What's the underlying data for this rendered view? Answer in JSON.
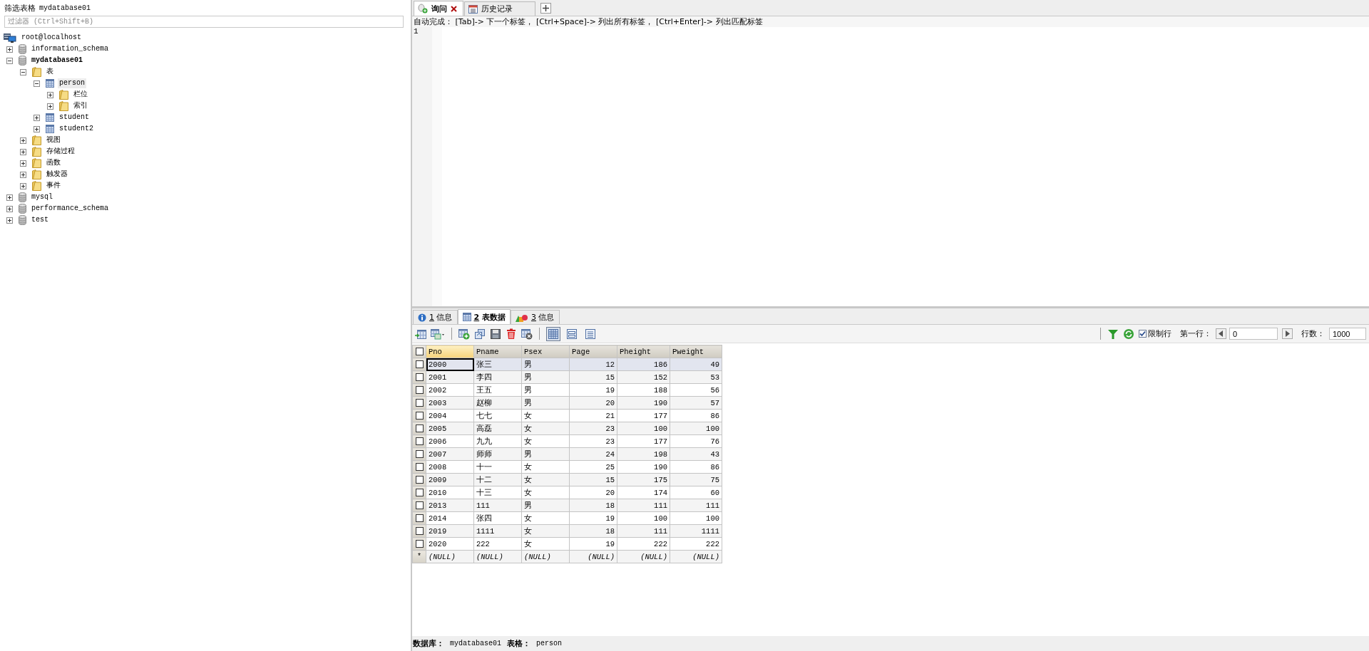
{
  "sidebar": {
    "title": "筛选表格",
    "database": "mydatabase01",
    "filter_placeholder": "过滤器 (Ctrl+Shift+B)",
    "tree": [
      {
        "label": "root@localhost",
        "kind": "server",
        "selected": false,
        "active": false,
        "children": [
          {
            "label": "information_schema",
            "kind": "database",
            "expanded": false,
            "selected": false,
            "active": false
          },
          {
            "label": "mydatabase01",
            "kind": "database",
            "expanded": true,
            "selected": false,
            "active": true,
            "children": [
              {
                "label": "表",
                "kind": "folder",
                "expanded": true,
                "selected": false,
                "active": false,
                "children": [
                  {
                    "label": "person",
                    "kind": "table",
                    "expanded": true,
                    "selected": true,
                    "active": false,
                    "children": [
                      {
                        "label": "栏位",
                        "kind": "folder",
                        "expanded": false,
                        "selected": false,
                        "active": false
                      },
                      {
                        "label": "索引",
                        "kind": "folder",
                        "expanded": false,
                        "selected": false,
                        "active": false
                      }
                    ]
                  },
                  {
                    "label": "student",
                    "kind": "table",
                    "expanded": false,
                    "selected": false,
                    "active": false
                  },
                  {
                    "label": "student2",
                    "kind": "table",
                    "expanded": false,
                    "selected": false,
                    "active": false
                  }
                ]
              },
              {
                "label": "视图",
                "kind": "folder",
                "expanded": false,
                "selected": false,
                "active": false
              },
              {
                "label": "存储过程",
                "kind": "folder",
                "expanded": false,
                "selected": false,
                "active": false
              },
              {
                "label": "函数",
                "kind": "folder",
                "expanded": false,
                "selected": false,
                "active": false
              },
              {
                "label": "触发器",
                "kind": "folder",
                "expanded": false,
                "selected": false,
                "active": false
              },
              {
                "label": "事件",
                "kind": "folder",
                "expanded": false,
                "selected": false,
                "active": false
              }
            ]
          },
          {
            "label": "mysql",
            "kind": "database",
            "expanded": false,
            "selected": false,
            "active": false
          },
          {
            "label": "performance_schema",
            "kind": "database",
            "expanded": false,
            "selected": false,
            "active": false
          },
          {
            "label": "test",
            "kind": "database",
            "expanded": false,
            "selected": false,
            "active": false
          }
        ]
      }
    ]
  },
  "editor": {
    "tabs": [
      {
        "label": "询问",
        "kind": "query",
        "selected": true,
        "closable": true
      },
      {
        "label": "历史记录",
        "kind": "history",
        "selected": false,
        "closable": false
      }
    ],
    "hint": "自动完成： [Tab]-> 下一个标签， [Ctrl+Space]-> 列出所有标签， [Ctrl+Enter]-> 列出匹配标签",
    "line_numbers": [
      "1"
    ]
  },
  "results": {
    "tabs": [
      {
        "number": "1",
        "label": "信息",
        "kind": "info",
        "selected": false
      },
      {
        "number": "2",
        "label": "表数据",
        "kind": "table",
        "selected": true
      },
      {
        "number": "3",
        "label": "信息",
        "kind": "profile",
        "selected": false
      }
    ],
    "view_modes": [
      {
        "kind": "grid",
        "selected": true
      },
      {
        "kind": "form",
        "selected": false
      },
      {
        "kind": "text",
        "selected": false
      }
    ],
    "limit_rows": {
      "label": "限制行",
      "checked": true
    },
    "first_row": {
      "label": "第一行：",
      "value": "0"
    },
    "row_count": {
      "label": "行数：",
      "value": "1000"
    },
    "table": {
      "all_checked": false,
      "columns": [
        {
          "label": "Pno",
          "kind": "text",
          "selected": true
        },
        {
          "label": "Pname",
          "kind": "text",
          "selected": false
        },
        {
          "label": "Psex",
          "kind": "text",
          "selected": false
        },
        {
          "label": "Page",
          "kind": "number",
          "selected": false
        },
        {
          "label": "Pheight",
          "kind": "number",
          "selected": false
        },
        {
          "label": "Pweight",
          "kind": "number",
          "selected": false
        }
      ],
      "rows": [
        {
          "selected": true,
          "checked": false,
          "cells": [
            "2000",
            "张三",
            "男",
            "12",
            "186",
            "49"
          ]
        },
        {
          "selected": false,
          "checked": false,
          "cells": [
            "2001",
            "李四",
            "男",
            "15",
            "152",
            "53"
          ]
        },
        {
          "selected": false,
          "checked": false,
          "cells": [
            "2002",
            "王五",
            "男",
            "19",
            "188",
            "56"
          ]
        },
        {
          "selected": false,
          "checked": false,
          "cells": [
            "2003",
            "赵柳",
            "男",
            "20",
            "190",
            "57"
          ]
        },
        {
          "selected": false,
          "checked": false,
          "cells": [
            "2004",
            "七七",
            "女",
            "21",
            "177",
            "86"
          ]
        },
        {
          "selected": false,
          "checked": false,
          "cells": [
            "2005",
            "高磊",
            "女",
            "23",
            "100",
            "100"
          ]
        },
        {
          "selected": false,
          "checked": false,
          "cells": [
            "2006",
            "九九",
            "女",
            "23",
            "177",
            "76"
          ]
        },
        {
          "selected": false,
          "checked": false,
          "cells": [
            "2007",
            "师师",
            "男",
            "24",
            "198",
            "43"
          ]
        },
        {
          "selected": false,
          "checked": false,
          "cells": [
            "2008",
            "十一",
            "女",
            "25",
            "190",
            "86"
          ]
        },
        {
          "selected": false,
          "checked": false,
          "cells": [
            "2009",
            "十二",
            "女",
            "15",
            "175",
            "75"
          ]
        },
        {
          "selected": false,
          "checked": false,
          "cells": [
            "2010",
            "十三",
            "女",
            "20",
            "174",
            "60"
          ]
        },
        {
          "selected": false,
          "checked": false,
          "cells": [
            "2013",
            "111",
            "男",
            "18",
            "111",
            "111"
          ]
        },
        {
          "selected": false,
          "checked": false,
          "cells": [
            "2014",
            "张四",
            "女",
            "19",
            "100",
            "100"
          ]
        },
        {
          "selected": false,
          "checked": false,
          "cells": [
            "2019",
            "1111",
            "女",
            "18",
            "111",
            "1111"
          ]
        },
        {
          "selected": false,
          "checked": false,
          "cells": [
            "2020",
            "222",
            "女",
            "19",
            "222",
            "222"
          ]
        }
      ],
      "new_row": {
        "marker": "*",
        "cells": [
          "(NULL)",
          "(NULL)",
          "(NULL)",
          "(NULL)",
          "(NULL)",
          "(NULL)"
        ]
      }
    }
  },
  "status_bar": {
    "database_label": "数据库：",
    "database": "mydatabase01",
    "table_label": "表格：",
    "table": "person"
  }
}
